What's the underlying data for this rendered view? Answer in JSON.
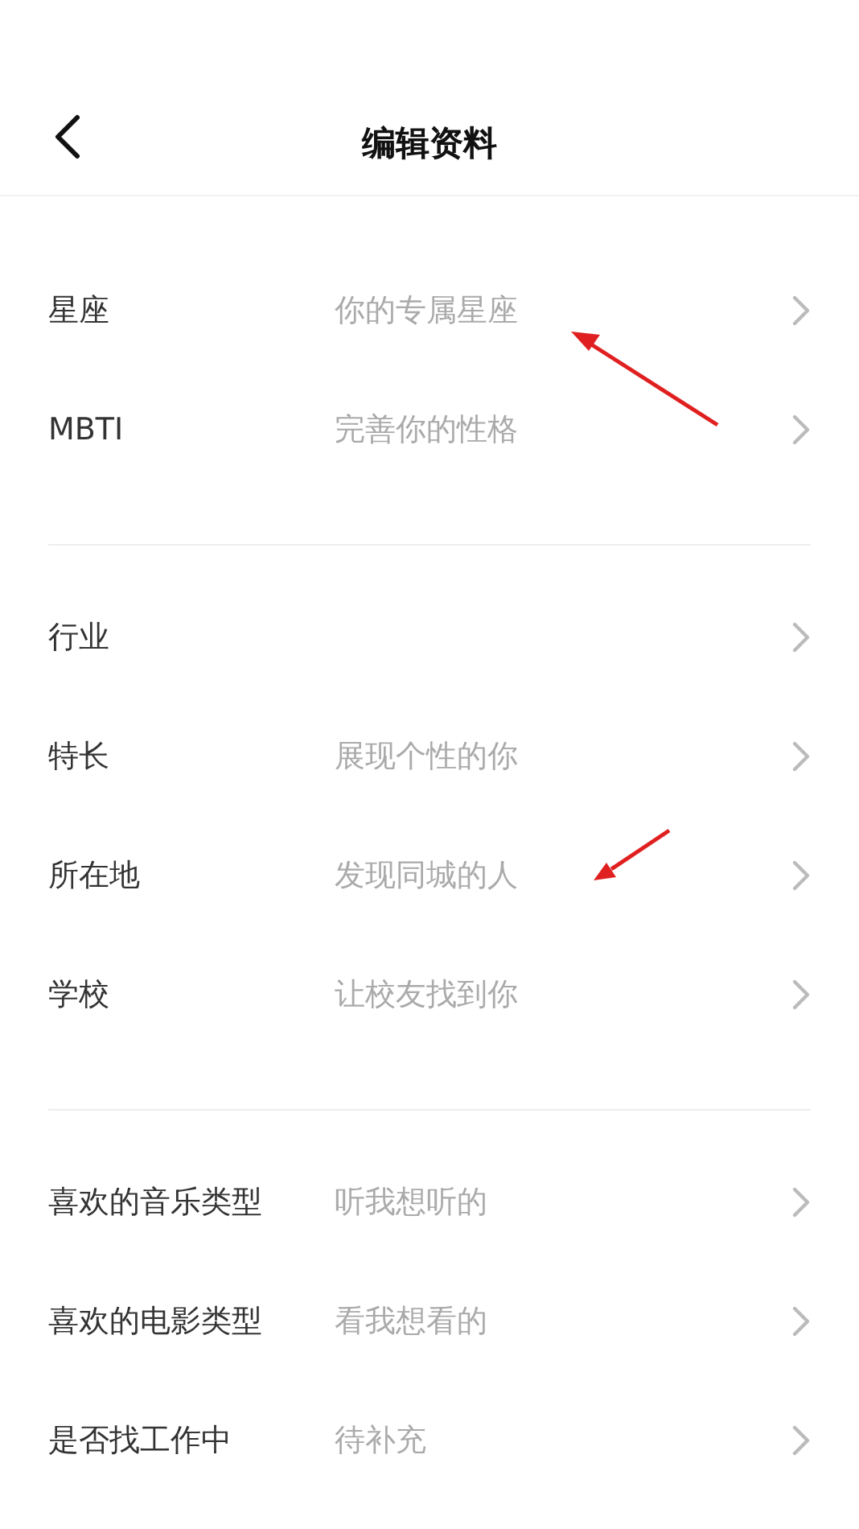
{
  "header": {
    "title": "编辑资料"
  },
  "sections": [
    {
      "rows": [
        {
          "label": "星座",
          "value": "你的专属星座"
        },
        {
          "label": "MBTI",
          "value": "完善你的性格"
        }
      ]
    },
    {
      "rows": [
        {
          "label": "行业"
        },
        {
          "label": "特长",
          "value": "展现个性的你"
        },
        {
          "label": "所在地",
          "value": "发现同城的人"
        },
        {
          "label": "学校",
          "value": "让校友找到你"
        }
      ]
    },
    {
      "rows": [
        {
          "label": "喜欢的音乐类型",
          "value": "听我想听的"
        },
        {
          "label": "喜欢的电影类型",
          "value": "看我想看的"
        },
        {
          "label": "是否找工作中",
          "value": "待补充"
        }
      ]
    }
  ]
}
